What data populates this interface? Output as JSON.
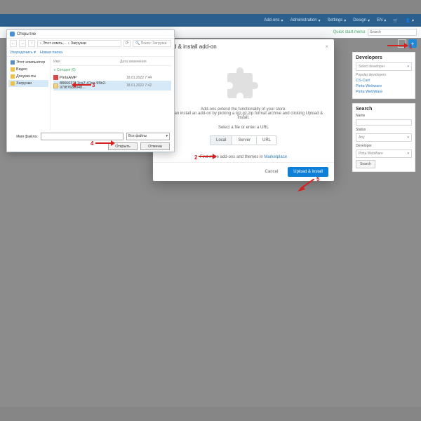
{
  "nav": {
    "addons": "Add-ons",
    "admin": "Administration",
    "settings": "Settings",
    "design": "Design",
    "lang": "EN"
  },
  "quick": {
    "menu": "Quick start menu",
    "search_ph": "Search"
  },
  "side": {
    "dev_h": "Developers",
    "dev_sel": "Select developer",
    "dev_pop": "Popular developers",
    "d1": "CS-Cart",
    "d2": "Pinta Webware",
    "d3": "Pinta WebWare",
    "search_h": "Search",
    "name": "Name",
    "status": "Status",
    "any": "Any",
    "devlbl": "Developer",
    "devv": "Pinta WebWare",
    "sbtn": "Search"
  },
  "modal": {
    "title": "Upload & install add-on",
    "l1": "Add-ons extend the functionality of your store.",
    "l2": "You can install an add-on by picking a tgz,gz,zip format archive and clicking Upload & install.",
    "sel": "Select a file or enter a URL",
    "t1": "Local",
    "t2": "Server",
    "t3": "URL",
    "mkt1": "Find more add-ons and themes in ",
    "mkt2": "Marketplace",
    "cancel": "Cancel",
    "ok": "Upload & install"
  },
  "fd": {
    "title": "Открытие",
    "crumb1": "Этот компь…",
    "crumb2": "Загрузки",
    "search": "Поиск: Загрузки",
    "org": "Упорядочить",
    "newf": "Новая папка",
    "s1": "Этот компьютер",
    "s2": "Видео",
    "s3": "Документы",
    "s4": "Загрузки",
    "col1": "Имя",
    "col2": "Дата изменения",
    "grp": "Сегодня (6)",
    "f1": "PintaAMP",
    "f1d": "18.01.2022  7:44",
    "f2": "8866637f-1ca7-41ce-95b2-978f768e948…",
    "f2d": "18.01.2022  7:42",
    "fname": "Имя файла:",
    "filter": "Все файлы",
    "open": "Открыть",
    "cancel": "Отмена"
  }
}
